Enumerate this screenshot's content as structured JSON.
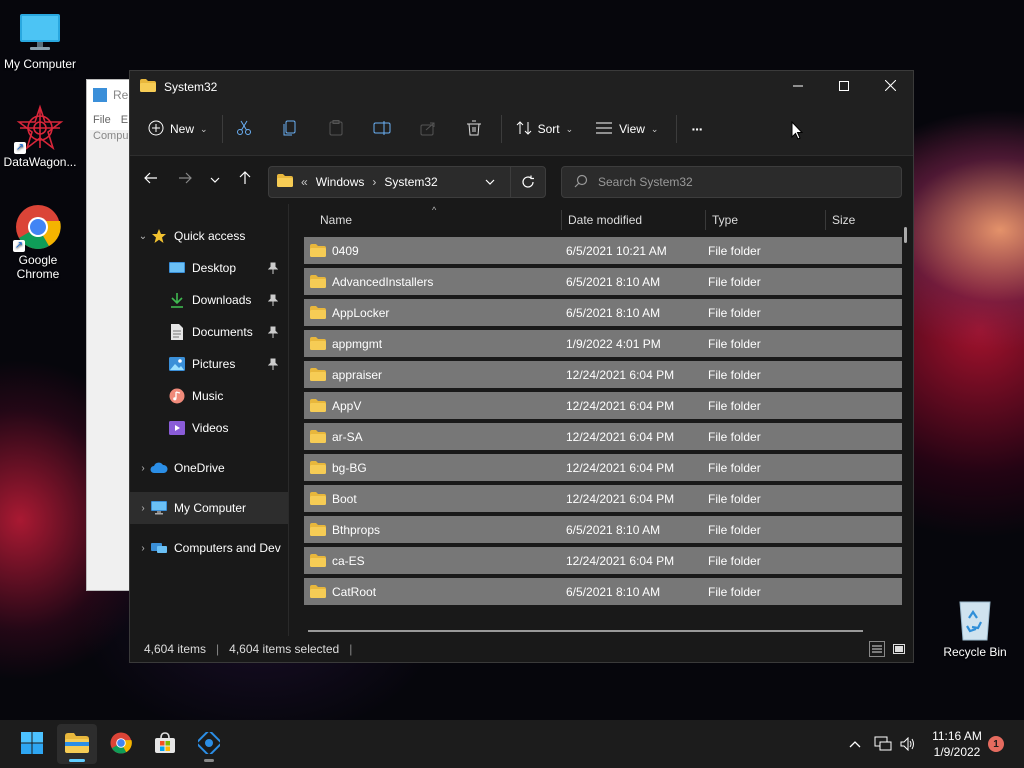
{
  "desktop": {
    "icons": [
      {
        "label": "My Computer",
        "icon": "monitor-icon"
      },
      {
        "label": "DataWagon...",
        "icon": "datawagon-logo-icon"
      },
      {
        "label": "Google Chrome",
        "icon": "chrome-icon"
      },
      {
        "label": "Recycle Bin",
        "icon": "recycle-bin-icon"
      }
    ]
  },
  "background_window": {
    "title": "Re",
    "menu": [
      "File",
      "E"
    ],
    "sub": "Compu"
  },
  "window": {
    "title": "System32",
    "controls": {
      "minimize": "minimize-icon",
      "maximize": "maximize-icon",
      "close": "close-icon"
    }
  },
  "toolbar": {
    "new_label": "New",
    "sort_label": "Sort",
    "view_label": "View",
    "more_label": "···",
    "icons": [
      "cut-icon",
      "copy-icon",
      "paste-icon",
      "rename-icon",
      "share-icon",
      "delete-icon"
    ]
  },
  "address": {
    "overflow": "«",
    "crumbs": [
      "Windows",
      "System32"
    ],
    "separator": "›"
  },
  "search": {
    "placeholder": "Search System32"
  },
  "nav": {
    "quick_access": "Quick access",
    "items": [
      {
        "label": "Desktop",
        "icon": "desktop-icon",
        "pinned": true
      },
      {
        "label": "Downloads",
        "icon": "download-icon",
        "pinned": true
      },
      {
        "label": "Documents",
        "icon": "document-icon",
        "pinned": true
      },
      {
        "label": "Pictures",
        "icon": "pictures-icon",
        "pinned": true
      },
      {
        "label": "Music",
        "icon": "music-icon",
        "pinned": false
      },
      {
        "label": "Videos",
        "icon": "videos-icon",
        "pinned": false
      }
    ],
    "onedrive": "OneDrive",
    "my_computer": "My Computer",
    "network": "Computers and Dev"
  },
  "columns": {
    "name": "Name",
    "date": "Date modified",
    "type": "Type",
    "size": "Size"
  },
  "files": [
    {
      "name": "0409",
      "date": "6/5/2021 10:21 AM",
      "type": "File folder"
    },
    {
      "name": "AdvancedInstallers",
      "date": "6/5/2021 8:10 AM",
      "type": "File folder"
    },
    {
      "name": "AppLocker",
      "date": "6/5/2021 8:10 AM",
      "type": "File folder"
    },
    {
      "name": "appmgmt",
      "date": "1/9/2022 4:01 PM",
      "type": "File folder"
    },
    {
      "name": "appraiser",
      "date": "12/24/2021 6:04 PM",
      "type": "File folder"
    },
    {
      "name": "AppV",
      "date": "12/24/2021 6:04 PM",
      "type": "File folder"
    },
    {
      "name": "ar-SA",
      "date": "12/24/2021 6:04 PM",
      "type": "File folder"
    },
    {
      "name": "bg-BG",
      "date": "12/24/2021 6:04 PM",
      "type": "File folder"
    },
    {
      "name": "Boot",
      "date": "12/24/2021 6:04 PM",
      "type": "File folder"
    },
    {
      "name": "Bthprops",
      "date": "6/5/2021 8:10 AM",
      "type": "File folder"
    },
    {
      "name": "ca-ES",
      "date": "12/24/2021 6:04 PM",
      "type": "File folder"
    },
    {
      "name": "CatRoot",
      "date": "6/5/2021 8:10 AM",
      "type": "File folder"
    }
  ],
  "status": {
    "items": "4,604 items",
    "selected": "4,604 items selected",
    "divider": "|"
  },
  "taskbar": {
    "apps": [
      "start-icon",
      "file-explorer-icon",
      "chrome-icon",
      "store-icon",
      "datawagon-icon"
    ],
    "tray_icons": [
      "chevron-up-icon",
      "network-icon",
      "volume-icon"
    ],
    "time": "11:16 AM",
    "date": "1/9/2022",
    "notifications": "1"
  },
  "colors": {
    "accent": "#60cdff",
    "folder": "#e8b73c",
    "selection_row": "#777777",
    "window_bg": "#191919",
    "notification_badge": "#e56b5f"
  }
}
